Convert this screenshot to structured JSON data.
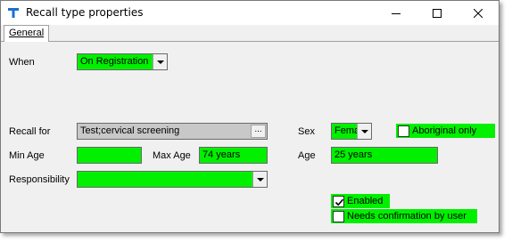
{
  "window": {
    "title": "Recall type properties"
  },
  "tabs": [
    {
      "label": "General"
    }
  ],
  "form": {
    "when_label": "When",
    "when_value": "On Registration",
    "recall_for_label": "Recall for",
    "recall_for_value": "Test;cervical screening",
    "recall_for_button": "...",
    "sex_label": "Sex",
    "sex_value": "Fema",
    "aboriginal_label": "Aboriginal only",
    "aboriginal_checked": false,
    "min_age_label": "Min Age",
    "min_age_value": "",
    "max_age_label": "Max Age",
    "max_age_value": "74 years",
    "age_label": "Age",
    "age_value": "25 years",
    "responsibility_label": "Responsibility",
    "responsibility_value": "",
    "enabled_label": "Enabled",
    "enabled_checked": true,
    "needs_confirmation_label": "Needs confirmation by user",
    "needs_confirmation_checked": false
  },
  "colors": {
    "field_highlight": "#00f000",
    "brand_icon": "#1a6fd1"
  },
  "icons": {
    "app": "telstra-logo-icon",
    "minimize": "minimize-icon",
    "maximize": "maximize-icon",
    "close": "close-icon"
  }
}
